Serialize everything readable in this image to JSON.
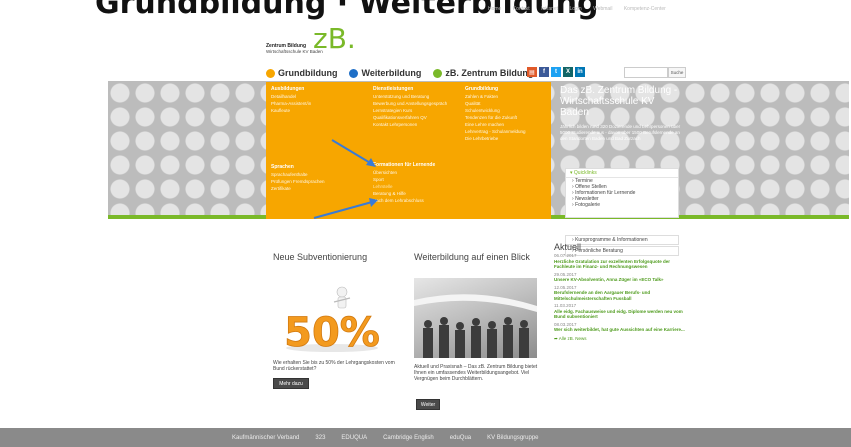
{
  "page": {
    "heading": "Grundbildung · Weiterbildung"
  },
  "toplinks": [
    "Home",
    "Kontakt",
    "Intranet",
    "Login",
    "Webmail",
    "Kompetenz-Center"
  ],
  "logo": {
    "mark": "zB.",
    "line1": "Zentrum Bildung",
    "line2": "Wirtschaftsschule KV Baden"
  },
  "nav": {
    "items": [
      {
        "label": "Grundbildung",
        "color": "#f7a600"
      },
      {
        "label": "Weiterbildung",
        "color": "#1f6fc7"
      },
      {
        "label": "zB. Zentrum Bildung",
        "color": "#7ab929"
      }
    ]
  },
  "social": [
    {
      "icon": "rss-icon",
      "glyph": "▤",
      "color": "#e05a2a"
    },
    {
      "icon": "facebook-icon",
      "glyph": "f",
      "color": "#3b5998"
    },
    {
      "icon": "twitter-icon",
      "glyph": "t",
      "color": "#1da1f2"
    },
    {
      "icon": "xing-icon",
      "glyph": "X",
      "color": "#126567"
    },
    {
      "icon": "linkedin-icon",
      "glyph": "in",
      "color": "#0077b5"
    }
  ],
  "search": {
    "placeholder": "",
    "button": "Suche"
  },
  "mega": {
    "col1": {
      "heading": "Ausbildungen",
      "items": [
        "Detailhandel",
        "Pharma-Assistent/in",
        "Kaufleute"
      ],
      "heading2": "Sprachen",
      "items2": [
        "Sprachaufenthalte",
        "Prüfungen Fremdsprachen",
        "Zertifikate"
      ]
    },
    "col2": {
      "heading": "Dienstleistungen",
      "items": [
        "Unterstützung und Beratung",
        "Bewerbung und Anstellungsgespräch",
        "Lernstrategien Kurs",
        "Qualifikationsverfahren QV",
        "Kontakt Lehrpersonen"
      ],
      "heading2": "Formationen für Lernende",
      "items2": [
        "Übersichten",
        "Sport",
        "Lehrstelle",
        "Beratung & Hilfe",
        "Nach dem Lehrabschluss"
      ]
    },
    "col3": {
      "heading": "Grundbildung",
      "items": [
        "Zahlen & Fakten",
        "Qualität",
        "Schulentwicklung",
        "Tendenzen für die Zukunft",
        "Eine Lehre machen",
        "Lehrvertrag - Schulanmeldung",
        "Die Lehrbetriebe"
      ]
    }
  },
  "info": {
    "title": "Das zB. Zentrum Bildung - Wirtschaftsschule KV Baden",
    "text": "Jährlich bilden rund 320 Dozierende und Lehrpersonen über 5000 Studierende aus - davon über 1500 Berufslernende an den Standorten Baden und Bad Zurzach"
  },
  "quicklinks": {
    "heading": "Quicklinks",
    "items": [
      "Termine",
      "Offene Stellen",
      "Informationen für Lernende",
      "Newsletter",
      "Fotogalerie"
    ],
    "collapsed1": "Kursprogramme & Informationen",
    "collapsed2": "Persönliche Beratung"
  },
  "subv": {
    "title": "Neue Subventionierung",
    "badge": "50%",
    "text": "Wie erhalten Sie bis zu 50% der Lehrgangskosten vom Bund rückerstattet?",
    "button": "Mehr dazu"
  },
  "weiter": {
    "title": "Weiterbildung auf einen Blick",
    "text": "Aktuell und Praxisnah – Das zB. Zentrum Bildung bietet Ihnen ein umfassendes Weiterbildungsangebot. Viel Vergnügen beim Durchblättern.",
    "button": "Weiter"
  },
  "news": {
    "title": "Aktuell",
    "items": [
      {
        "date": "06.07.2017",
        "headline": "Herzliche Gratulation zur exzellenten Erfolgsquote der Fachleute im Finanz- und Rechnungswesen"
      },
      {
        "date": "29.05.2017",
        "headline": "Unsere KV-Absolventin, Anna Züger im «ECO Talk»"
      },
      {
        "date": "12.05.2017",
        "headline": "Berufslernende an den Aargauer Berufs- und Mittelschulmeisterschaften Fussball"
      },
      {
        "date": "11.03.2017",
        "headline": "Alle eidg. Fachausweise und eidg. Diplome werden neu vom Bund subventioniert"
      },
      {
        "date": "08.03.2017",
        "headline": "Wer sich weiterbildet, hat gute Aussichten auf eine Karriere..."
      }
    ],
    "all_link": "Alle zB. News"
  },
  "footer": [
    "Kaufmännischer Verband",
    "323",
    "EDUQUA",
    "Cambridge English",
    "eduQua",
    "KV Bildungsgruppe"
  ]
}
